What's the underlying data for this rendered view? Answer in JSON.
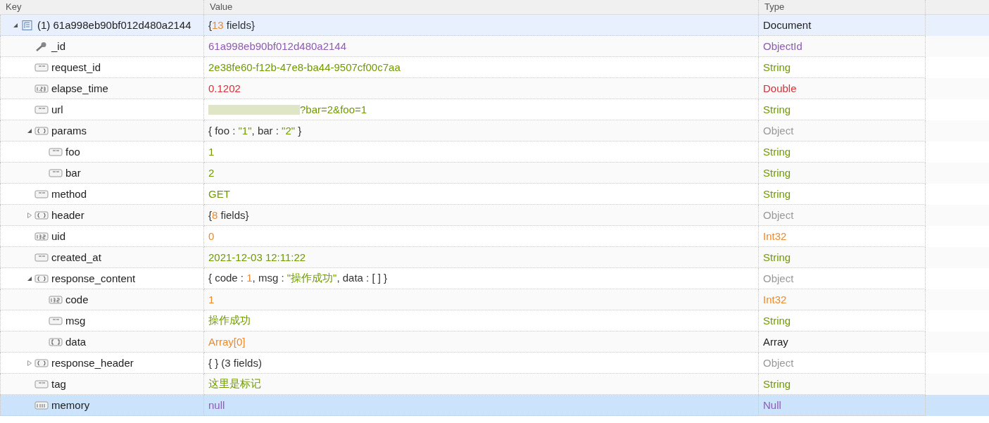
{
  "columns": [
    {
      "label": "Key"
    },
    {
      "label": "Value"
    },
    {
      "label": "Type"
    }
  ],
  "rows": [
    {
      "key": "(1) 61a998eb90bf012d480a2144",
      "kind": "document",
      "expanded": true,
      "selected": false,
      "value": [
        {
          "text": "{",
          "kind": "plain"
        },
        {
          "text": "13",
          "kind": "number"
        },
        {
          "text": " fields}",
          "kind": "plain"
        }
      ],
      "type": "Document",
      "children": [
        {
          "key": "_id",
          "kind": "objectid",
          "selected": false,
          "value": [
            {
              "text": "61a998eb90bf012d480a2144",
              "kind": "objectid"
            }
          ],
          "type": "ObjectId"
        },
        {
          "key": "request_id",
          "kind": "string",
          "selected": false,
          "value": [
            {
              "text": "2e38fe60-f12b-47e8-ba44-9507cf00c7aa",
              "kind": "string"
            }
          ],
          "type": "String"
        },
        {
          "key": "elapse_time",
          "kind": "double",
          "selected": false,
          "value": [
            {
              "text": "0.1202",
              "kind": "double"
            }
          ],
          "type": "Double"
        },
        {
          "key": "url",
          "kind": "string",
          "selected": false,
          "redacted": true,
          "value": [
            {
              "text": "?bar=2&foo=1",
              "kind": "string"
            }
          ],
          "type": "String"
        },
        {
          "key": "params",
          "kind": "object",
          "expanded": true,
          "selected": false,
          "value": [
            {
              "text": "{ foo : ",
              "kind": "plain"
            },
            {
              "text": "\"1\"",
              "kind": "string"
            },
            {
              "text": ", bar : ",
              "kind": "plain"
            },
            {
              "text": "\"2\"",
              "kind": "string"
            },
            {
              "text": " }",
              "kind": "plain"
            }
          ],
          "type": "Object",
          "children": [
            {
              "key": "foo",
              "kind": "string",
              "selected": false,
              "value": [
                {
                  "text": "1",
                  "kind": "string"
                }
              ],
              "type": "String"
            },
            {
              "key": "bar",
              "kind": "string",
              "selected": false,
              "value": [
                {
                  "text": "2",
                  "kind": "string"
                }
              ],
              "type": "String"
            }
          ]
        },
        {
          "key": "method",
          "kind": "string",
          "selected": false,
          "value": [
            {
              "text": "GET",
              "kind": "string"
            }
          ],
          "type": "String"
        },
        {
          "key": "header",
          "kind": "object",
          "expanded": false,
          "selected": false,
          "value": [
            {
              "text": "{",
              "kind": "plain"
            },
            {
              "text": "8",
              "kind": "number"
            },
            {
              "text": " fields}",
              "kind": "plain"
            }
          ],
          "type": "Object"
        },
        {
          "key": "uid",
          "kind": "int32",
          "selected": false,
          "value": [
            {
              "text": "0",
              "kind": "number"
            }
          ],
          "type": "Int32"
        },
        {
          "key": "created_at",
          "kind": "string",
          "selected": false,
          "value": [
            {
              "text": "2021-12-03 12:11:22",
              "kind": "string"
            }
          ],
          "type": "String"
        },
        {
          "key": "response_content",
          "kind": "object",
          "expanded": true,
          "selected": false,
          "value": [
            {
              "text": "{ code : ",
              "kind": "plain"
            },
            {
              "text": "1",
              "kind": "number"
            },
            {
              "text": ", msg : ",
              "kind": "plain"
            },
            {
              "text": "\"操作成功\"",
              "kind": "string"
            },
            {
              "text": ", data : [ ] }",
              "kind": "plain"
            }
          ],
          "type": "Object",
          "children": [
            {
              "key": "code",
              "kind": "int32",
              "selected": false,
              "value": [
                {
                  "text": "1",
                  "kind": "number"
                }
              ],
              "type": "Int32"
            },
            {
              "key": "msg",
              "kind": "string",
              "selected": false,
              "value": [
                {
                  "text": "操作成功",
                  "kind": "string"
                }
              ],
              "type": "String"
            },
            {
              "key": "data",
              "kind": "array",
              "selected": false,
              "value": [
                {
                  "text": "Array[0]",
                  "kind": "number"
                }
              ],
              "type": "Array"
            }
          ]
        },
        {
          "key": "response_header",
          "kind": "object",
          "expanded": false,
          "selected": false,
          "value": [
            {
              "text": "{ } (3 fields)",
              "kind": "plain"
            }
          ],
          "type": "Object"
        },
        {
          "key": "tag",
          "kind": "string",
          "selected": false,
          "value": [
            {
              "text": "这里是标记",
              "kind": "string"
            }
          ],
          "type": "String"
        },
        {
          "key": "memory",
          "kind": "null",
          "selected": true,
          "value": [
            {
              "text": "null",
              "kind": "null"
            }
          ],
          "type": "Null"
        }
      ]
    }
  ]
}
